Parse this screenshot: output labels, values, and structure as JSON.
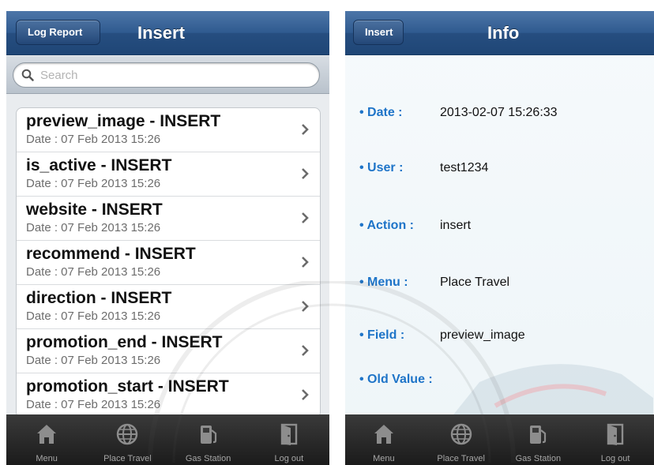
{
  "left_screen": {
    "back_button": "Log Report",
    "title": "Insert",
    "search": {
      "placeholder": "Search",
      "value": ""
    },
    "items": [
      {
        "title": "preview_image - INSERT",
        "date": "Date : 07 Feb 2013 15:26"
      },
      {
        "title": "is_active - INSERT",
        "date": "Date : 07 Feb 2013 15:26"
      },
      {
        "title": "website - INSERT",
        "date": "Date : 07 Feb 2013 15:26"
      },
      {
        "title": "recommend - INSERT",
        "date": "Date : 07 Feb 2013 15:26"
      },
      {
        "title": "direction - INSERT",
        "date": "Date : 07 Feb 2013 15:26"
      },
      {
        "title": "promotion_end - INSERT",
        "date": "Date : 07 Feb 2013 15:26"
      },
      {
        "title": "promotion_start - INSERT",
        "date": "Date : 07 Feb 2013 15:26"
      }
    ]
  },
  "right_screen": {
    "back_button": "Insert",
    "title": "Info",
    "fields": [
      {
        "label": "• Date :",
        "value": "2013-02-07 15:26:33"
      },
      {
        "label": "• User :",
        "value": "test1234"
      },
      {
        "label": "• Action :",
        "value": "insert"
      },
      {
        "label": "• Menu :",
        "value": "Place Travel"
      },
      {
        "label": "• Field :",
        "value": "preview_image"
      },
      {
        "label": "• Old Value :",
        "value": ""
      }
    ]
  },
  "tabbar": {
    "tabs": [
      {
        "label": "Menu",
        "icon": "home-icon"
      },
      {
        "label": "Place Travel",
        "icon": "globe-icon"
      },
      {
        "label": "Gas Station",
        "icon": "gas-pump-icon"
      },
      {
        "label": "Log out",
        "icon": "door-exit-icon"
      }
    ]
  },
  "colors": {
    "navbar": "#2f5a8f",
    "info_label": "#1e74c8",
    "tabbar": "#1b1b1b"
  }
}
